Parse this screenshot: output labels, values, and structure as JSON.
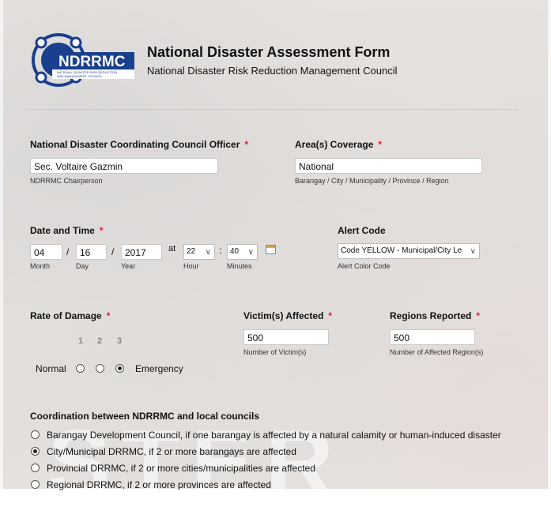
{
  "header": {
    "logo_text": "NDRRMC",
    "logo_subtext": "NATIONAL DISASTER RISK REDUCTION AND MANAGEMENT COUNCIL",
    "title": "National Disaster Assessment Form",
    "subtitle": "National Disaster Risk Reduction Management Council"
  },
  "officer": {
    "label": "National Disaster Coordinating Council Officer",
    "required": "*",
    "value": "Sec. Voltaire Gazmin",
    "sublabel": "NDRRMC Chairperson"
  },
  "coverage": {
    "label": "Area(s) Coverage",
    "required": "*",
    "value": "National",
    "sublabel": "Barangay / City / Municipality / Province / Region"
  },
  "datetime": {
    "label": "Date and Time",
    "required": "*",
    "month": "04",
    "day": "16",
    "year": "2017",
    "sep": "/",
    "at": "at",
    "colon": ":",
    "hour": "22",
    "minutes": "40",
    "month_label": "Month",
    "day_label": "Day",
    "year_label": "Year",
    "hour_label": "Hour",
    "minutes_label": "Minutes"
  },
  "alert": {
    "label": "Alert Code",
    "value": "Code YELLOW - Municipal/City Le",
    "sublabel": "Alert Color Code"
  },
  "damage": {
    "label": "Rate of Damage",
    "required": "*",
    "scale": [
      "1",
      "2",
      "3"
    ],
    "low": "Normal",
    "high": "Emergency",
    "selected": 3
  },
  "victims": {
    "label": "Victim(s) Affected",
    "required": "*",
    "value": "500",
    "sublabel": "Number of Victim(s)"
  },
  "regions": {
    "label": "Regions Reported",
    "required": "*",
    "value": "500",
    "sublabel": "Number of Affected Region(s)"
  },
  "coordination": {
    "label": "Coordination between NDRRMC and local councils",
    "options": [
      "Barangay Development Council, if one barangay is affected by a natural calamity or human-induced disaster",
      "City/Municipal DRRMC, if 2 or more barangays are affected",
      "Provincial DRRMC, if 2 or more cities/municipalities are affected",
      "Regional DRRMC, if 2 or more provinces are affected"
    ],
    "selected": 2
  },
  "colors": {
    "required": "#e0202a",
    "logo_blue": "#1b3f8f"
  }
}
